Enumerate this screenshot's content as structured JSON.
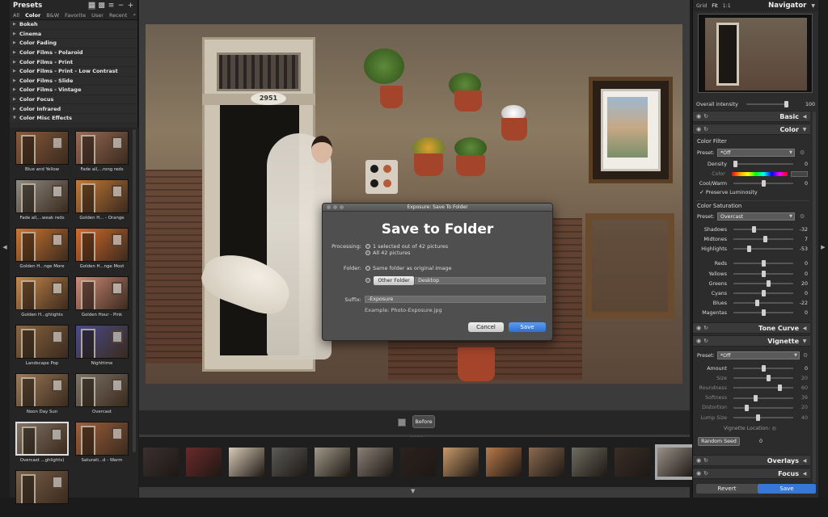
{
  "presets": {
    "title": "Presets",
    "tabs": [
      "All",
      "Color",
      "B&W",
      "Favorite",
      "User",
      "Recent"
    ],
    "active_tab": "Color",
    "categories": [
      "Bokeh",
      "Cinema",
      "Color Fading",
      "Color Films - Polaroid",
      "Color Films - Print",
      "Color Films - Print - Low Contrast",
      "Color Films - Slide",
      "Color Films - Vintage",
      "Color Focus",
      "Color Infrared",
      "Color Misc Effects"
    ],
    "open_category": "Color Misc Effects",
    "thumbnails": [
      {
        "label": "Blue and Yellow",
        "tint": "#8a5a3a"
      },
      {
        "label": "Fade all,...rong reds",
        "tint": "#9a6a55"
      },
      {
        "label": "Fade all,...weak reds",
        "tint": "#8e8a82"
      },
      {
        "label": "Golden H... - Orange",
        "tint": "#c67a36"
      },
      {
        "label": "Golden H...nge More",
        "tint": "#d0762f"
      },
      {
        "label": "Golden H...nge Most",
        "tint": "#d86a28"
      },
      {
        "label": "Golden H...ghlights",
        "tint": "#c9884a"
      },
      {
        "label": "Golden Hour - Pink",
        "tint": "#d08a78"
      },
      {
        "label": "Landscape Pop",
        "tint": "#8a6540"
      },
      {
        "label": "Nighttime",
        "tint": "#4a4c8a"
      },
      {
        "label": "Noon Day Sun",
        "tint": "#9c7a58"
      },
      {
        "label": "Overcast",
        "tint": "#7e7468"
      },
      {
        "label": "Overcast ...ghlights)",
        "tint": "#827566"
      },
      {
        "label": "Saturati...d - Warm",
        "tint": "#a0603a"
      },
      {
        "label": "",
        "tint": "#7a6048"
      }
    ]
  },
  "photo": {
    "house_number": "2951"
  },
  "toolbar": {
    "before_label": "Before"
  },
  "dialog": {
    "window_title": "Exposure: Save To Folder",
    "heading": "Save to Folder",
    "processing_label": "Processing:",
    "processing_options": [
      "1 selected out of 42 pictures",
      "All 42 pictures"
    ],
    "folder_label": "Folder:",
    "folder_option_same": "Same folder as original image",
    "other_folder_label": "Other Folder",
    "folder_value": "Desktop",
    "suffix_label": "Suffix:",
    "suffix_value": "-Exposure",
    "example": "Example: Photo-Exposure.jpg",
    "cancel_label": "Cancel",
    "save_label": "Save"
  },
  "navigator": {
    "view_modes": [
      "Grid",
      "Fit",
      "1:1"
    ],
    "active_view": "Fit",
    "title": "Navigator",
    "overall_intensity_label": "Overall intensity",
    "overall_intensity_value": "100",
    "overall_intensity_level": 1.0
  },
  "sections": {
    "basic": "Basic",
    "color": "Color",
    "tone_curve": "Tone Curve",
    "vignette": "Vignette",
    "overlays": "Overlays",
    "focus": "Focus"
  },
  "color_filter": {
    "title": "Color Filter",
    "preset_label": "Preset:",
    "preset_value": "*Off",
    "density_label": "Density",
    "density_value": "0",
    "color_label": "Color",
    "cool_warm_label": "Cool/Warm",
    "cool_warm_value": "0",
    "preserve_label": "Preserve Luminosity"
  },
  "color_saturation": {
    "title": "Color Saturation",
    "preset_label": "Preset:",
    "preset_value": "Overcast",
    "sliders": [
      {
        "label": "Shadows",
        "value": "-32",
        "level": 0.34
      },
      {
        "label": "Midtones",
        "value": "7",
        "level": 0.53
      },
      {
        "label": "Highlights",
        "value": "-53",
        "level": 0.24
      },
      {
        "label": "Reds",
        "value": "0",
        "level": 0.5
      },
      {
        "label": "Yellows",
        "value": "0",
        "level": 0.5
      },
      {
        "label": "Greens",
        "value": "20",
        "level": 0.6
      },
      {
        "label": "Cyans",
        "value": "0",
        "level": 0.5
      },
      {
        "label": "Blues",
        "value": "-22",
        "level": 0.39
      },
      {
        "label": "Magentas",
        "value": "0",
        "level": 0.5
      }
    ]
  },
  "vignette": {
    "preset_label": "Preset:",
    "preset_value": "*Off",
    "sliders": [
      {
        "label": "Amount",
        "value": "0",
        "level": 0.5,
        "dim": false
      },
      {
        "label": "Size",
        "value": "20",
        "level": 0.6,
        "dim": true
      },
      {
        "label": "Roundness",
        "value": "60",
        "level": 0.8,
        "dim": true
      },
      {
        "label": "Softness",
        "value": "36",
        "level": 0.36,
        "dim": true
      },
      {
        "label": "Distortion",
        "value": "20",
        "level": 0.2,
        "dim": true
      },
      {
        "label": "Lump Size",
        "value": "40",
        "level": 0.4,
        "dim": true
      }
    ],
    "location_label": "Vignette Location:",
    "random_seed_label": "Random Seed",
    "random_seed_value": "0"
  },
  "footer": {
    "revert_label": "Revert",
    "save_label": "Save"
  },
  "colors": {
    "accent": "#3677d8",
    "panel": "#2c2c2c"
  }
}
